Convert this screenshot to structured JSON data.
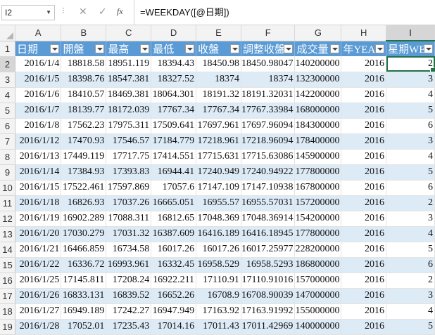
{
  "formula_bar": {
    "name_box": "I2",
    "cancel_icon": "✕",
    "enter_icon": "✓",
    "fx_label": "fx",
    "formula": "=WEEKDAY([@日期])"
  },
  "columns": [
    "A",
    "B",
    "C",
    "D",
    "E",
    "F",
    "G",
    "H",
    "I"
  ],
  "selected_column": "I",
  "header_row": {
    "row_number": "1",
    "labels": [
      "日期",
      "開盤",
      "最高",
      "最低",
      "收盤",
      "調整收盤",
      "成交量",
      "年YEAR",
      "星期WE"
    ]
  },
  "rows": [
    {
      "n": "2",
      "cells": [
        "2016/1/4",
        "18818.58",
        "18951.119",
        "18394.43",
        "18450.98",
        "18450.98047",
        "140200000",
        "2016",
        "2"
      ]
    },
    {
      "n": "3",
      "cells": [
        "2016/1/5",
        "18398.76",
        "18547.381",
        "18327.52",
        "18374",
        "18374",
        "132300000",
        "2016",
        "3"
      ]
    },
    {
      "n": "4",
      "cells": [
        "2016/1/6",
        "18410.57",
        "18469.381",
        "18064.301",
        "18191.32",
        "18191.32031",
        "142200000",
        "2016",
        "4"
      ]
    },
    {
      "n": "5",
      "cells": [
        "2016/1/7",
        "18139.77",
        "18172.039",
        "17767.34",
        "17767.34",
        "17767.33984",
        "168000000",
        "2016",
        "5"
      ]
    },
    {
      "n": "6",
      "cells": [
        "2016/1/8",
        "17562.23",
        "17975.311",
        "17509.641",
        "17697.961",
        "17697.96094",
        "184300000",
        "2016",
        "6"
      ]
    },
    {
      "n": "7",
      "cells": [
        "2016/1/12",
        "17470.93",
        "17546.57",
        "17184.779",
        "17218.961",
        "17218.96094",
        "178400000",
        "2016",
        "3"
      ]
    },
    {
      "n": "8",
      "cells": [
        "2016/1/13",
        "17449.119",
        "17717.75",
        "17414.551",
        "17715.631",
        "17715.63086",
        "145900000",
        "2016",
        "4"
      ]
    },
    {
      "n": "9",
      "cells": [
        "2016/1/14",
        "17384.93",
        "17393.83",
        "16944.41",
        "17240.949",
        "17240.94922",
        "177800000",
        "2016",
        "5"
      ]
    },
    {
      "n": "10",
      "cells": [
        "2016/1/15",
        "17522.461",
        "17597.869",
        "17057.6",
        "17147.109",
        "17147.10938",
        "167800000",
        "2016",
        "6"
      ]
    },
    {
      "n": "11",
      "cells": [
        "2016/1/18",
        "16826.93",
        "17037.26",
        "16665.051",
        "16955.57",
        "16955.57031",
        "157200000",
        "2016",
        "2"
      ]
    },
    {
      "n": "12",
      "cells": [
        "2016/1/19",
        "16902.289",
        "17088.311",
        "16812.65",
        "17048.369",
        "17048.36914",
        "154200000",
        "2016",
        "3"
      ]
    },
    {
      "n": "13",
      "cells": [
        "2016/1/20",
        "17030.279",
        "17031.32",
        "16387.609",
        "16416.189",
        "16416.18945",
        "177800000",
        "2016",
        "4"
      ]
    },
    {
      "n": "14",
      "cells": [
        "2016/1/21",
        "16466.859",
        "16734.58",
        "16017.26",
        "16017.26",
        "16017.25977",
        "228200000",
        "2016",
        "5"
      ]
    },
    {
      "n": "15",
      "cells": [
        "2016/1/22",
        "16336.72",
        "16993.961",
        "16332.45",
        "16958.529",
        "16958.5293",
        "186800000",
        "2016",
        "6"
      ]
    },
    {
      "n": "16",
      "cells": [
        "2016/1/25",
        "17145.811",
        "17208.24",
        "16922.211",
        "17110.91",
        "17110.91016",
        "157000000",
        "2016",
        "2"
      ]
    },
    {
      "n": "17",
      "cells": [
        "2016/1/26",
        "16833.131",
        "16839.52",
        "16652.26",
        "16708.9",
        "16708.90039",
        "147000000",
        "2016",
        "3"
      ]
    },
    {
      "n": "18",
      "cells": [
        "2016/1/27",
        "16949.189",
        "17242.27",
        "16947.949",
        "17163.92",
        "17163.91992",
        "155000000",
        "2016",
        "4"
      ]
    },
    {
      "n": "19",
      "cells": [
        "2016/1/28",
        "17052.01",
        "17235.43",
        "17014.16",
        "17011.43",
        "17011.42969",
        "140000000",
        "2016",
        "5"
      ]
    }
  ],
  "colors": {
    "header_fill": "#5b9bd5",
    "band_fill": "#ddebf7",
    "selection": "#217346"
  }
}
